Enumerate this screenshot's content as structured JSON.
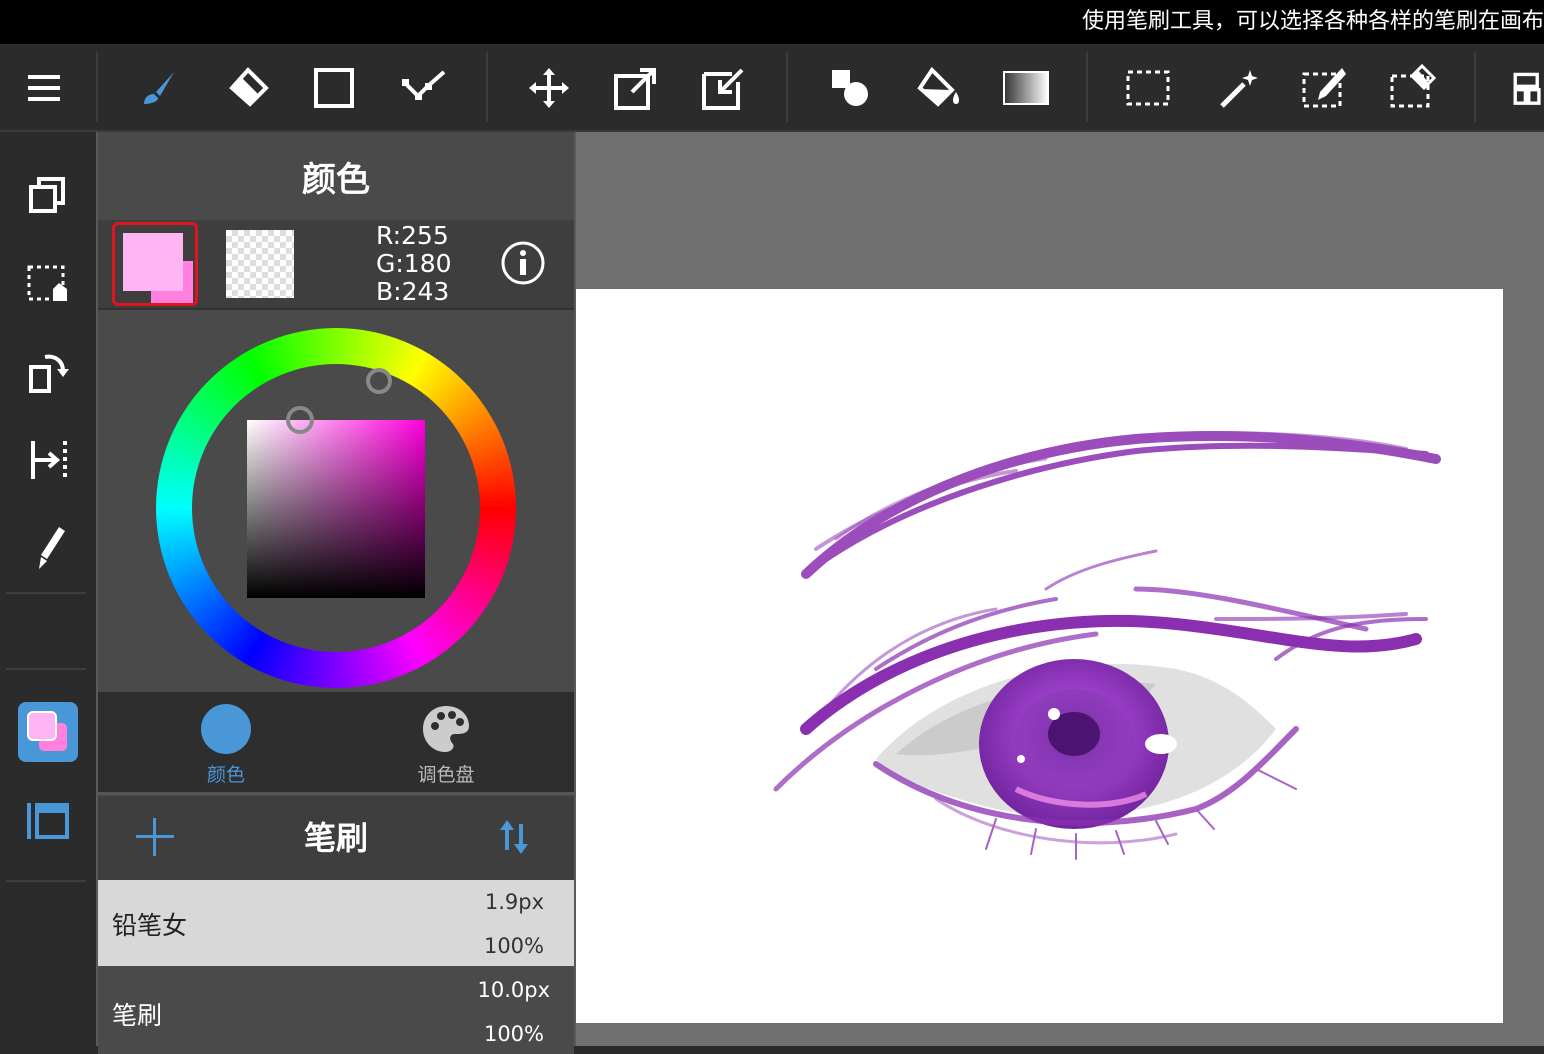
{
  "hint": "使用笔刷工具，可以选择各种各样的笔刷在画布",
  "color_panel": {
    "title": "颜色",
    "primary_color": "#ffb4f3",
    "secondary_color": "#ff80de",
    "r": "R:255",
    "g": "G:180",
    "b": "B:243",
    "tabs": [
      {
        "label": "颜色",
        "icon": "circle-icon",
        "active": true
      },
      {
        "label": "调色盘",
        "icon": "palette-icon",
        "active": false
      }
    ]
  },
  "brush_panel": {
    "title": "笔刷",
    "items": [
      {
        "name": "铅笔女",
        "size": "1.9px",
        "opacity": "100%",
        "selected": true
      },
      {
        "name": "笔刷",
        "size": "10.0px",
        "opacity": "100%",
        "selected": false
      }
    ]
  },
  "colors": {
    "accent": "#4a97d8",
    "toolbar": "#2b2b2b",
    "panel": "#4a4a4a",
    "canvas_bg": "#707070",
    "eye_purple": "#8a2fb0"
  }
}
